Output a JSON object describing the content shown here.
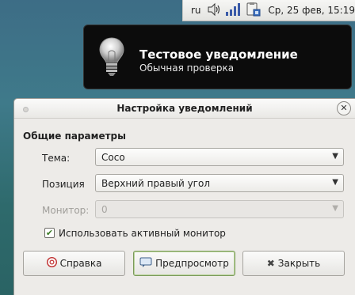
{
  "panel": {
    "lang": "ru",
    "volume_icon": "speaker-icon",
    "signal_icon": "signal-bars-icon",
    "clipboard_icon": "clipboard-icon",
    "clock": "Ср, 25 фев, 15:19"
  },
  "notification": {
    "icon": "lightbulb-icon",
    "title": "Тестовое уведомление",
    "body": "Обычная проверка"
  },
  "dialog": {
    "title": "Настройка уведомлений",
    "section": "Общие параметры",
    "theme_label": "Тема:",
    "theme_value": "Coco",
    "position_label": "Позиция",
    "position_value": "Верхний правый угол",
    "monitor_label": "Монитор:",
    "monitor_value": "0",
    "use_active_monitor_label": "Использовать активный монитор",
    "use_active_monitor_checked": true,
    "help_label": "Справка",
    "preview_label": "Предпросмотр",
    "close_label": "Закрыть"
  },
  "colors": {
    "desktop": "#3f7a8a",
    "notification_bg": "#0c0c0c",
    "dialog_bg": "#edebe8"
  }
}
